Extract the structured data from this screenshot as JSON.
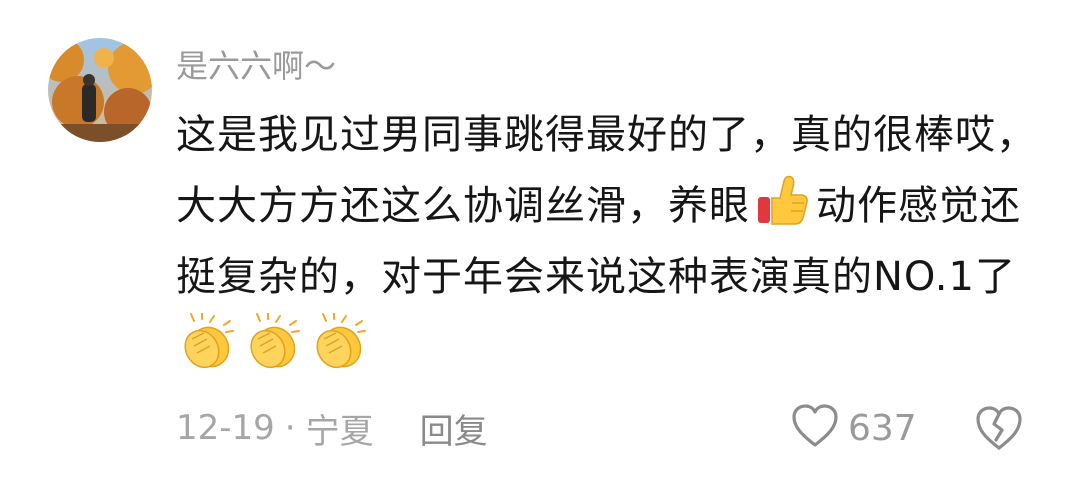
{
  "comment": {
    "username": "是六六啊～",
    "text_parts": [
      "这是我见过男同事跳得最好的了，真的很棒哎，大大方方还这么协调丝滑，养眼",
      "动作感觉还挺复杂的，对于年会来说这种表演真的NO.1了"
    ],
    "emojis": [
      "thumbs-up",
      "clapping-hands",
      "clapping-hands",
      "clapping-hands"
    ],
    "date": "12-19",
    "separator": "·",
    "location": "宁夏",
    "reply_label": "回复",
    "like_count": "637",
    "icons": [
      "heart-icon",
      "broken-heart-icon"
    ],
    "colors": {
      "meta_gray": "#a6a6a6",
      "text": "#161616",
      "emoji_yellow": "#ffc83d"
    }
  }
}
